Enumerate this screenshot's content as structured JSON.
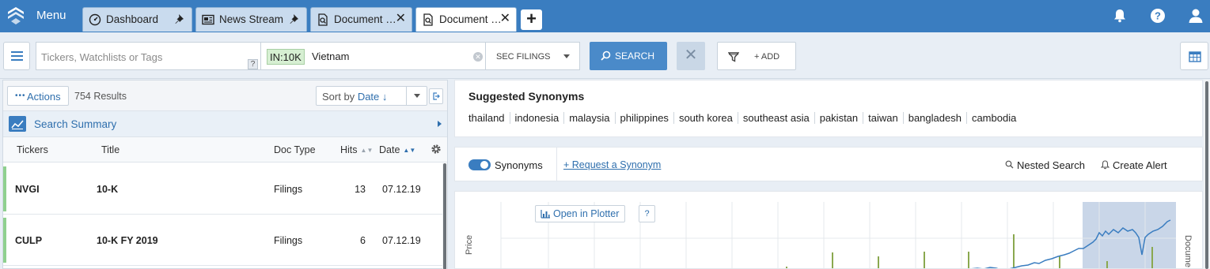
{
  "topbar": {
    "menu_label": "Menu",
    "tabs": [
      {
        "label": "Dashboard",
        "icon": "dashboard-icon",
        "pinned": true
      },
      {
        "label": "News Stream",
        "icon": "news-icon",
        "pinned": true
      },
      {
        "label": "Document …",
        "icon": "document-search-icon",
        "closable": true
      },
      {
        "label": "Document …",
        "icon": "document-search-icon",
        "closable": true,
        "active": true
      }
    ],
    "new_tab_label": "+",
    "bar_color": "#3a7dc0"
  },
  "search": {
    "ticker_placeholder": "Tickers, Watchlists or Tags",
    "help_label": "?",
    "filter_tag": "IN:10K",
    "query": "Vietnam",
    "scope": "SEC FILINGS",
    "search_label": "SEARCH",
    "clear_label": "✕",
    "add_label": "+ ADD"
  },
  "results": {
    "actions_label": "Actions",
    "count": "754 Results",
    "sort_prefix": "Sort by",
    "sort_value": "Date ↓",
    "summary_label": "Search Summary",
    "columns": [
      "Tickers",
      "Title",
      "Doc Type",
      "Hits",
      "Date"
    ],
    "rows": [
      {
        "ticker": "NVGI",
        "title": "10-K",
        "doc_type": "Filings",
        "hits": "13",
        "date": "07.12.19"
      },
      {
        "ticker": "CULP",
        "title": "10-K FY 2019",
        "doc_type": "Filings",
        "hits": "6",
        "date": "07.12.19"
      }
    ]
  },
  "synonyms": {
    "title": "Suggested Synonyms",
    "items": [
      "thailand",
      "indonesia",
      "malaysia",
      "philippines",
      "south korea",
      "southeast asia",
      "pakistan",
      "taiwan",
      "bangladesh",
      "cambodia"
    ],
    "toggle_label": "Synonyms",
    "toggle_on": true,
    "request_label": "+ Request a Synonym",
    "nested_label": "Nested Search",
    "alert_label": "Create Alert"
  },
  "chart": {
    "plotter_label": "Open in Plotter",
    "help_label": "?",
    "y_left_label": "Price",
    "y_right_label": "Docume",
    "price_color": "#3a7dc0",
    "doc_bar_color": "#8aa84f",
    "highlight_color": "#c9d6e8"
  }
}
